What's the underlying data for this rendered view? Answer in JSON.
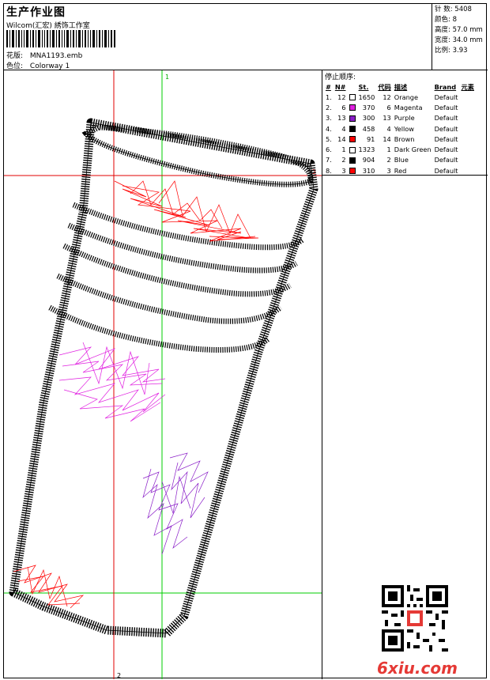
{
  "header": {
    "title": "生产作业图",
    "company": "Wilcom(汇宏) 綉饰工作室",
    "design_label": "花版:",
    "design_file": "MNA1193.emb",
    "colorway_label": "色位:",
    "colorway": "Colorway 1"
  },
  "stats": {
    "stitches_label": "针 数:",
    "stitches": "5408",
    "colors_label": "颜色:",
    "colors": "8",
    "height_label": "高度:",
    "height": "57.0 mm",
    "width_label": "宽度:",
    "width": "34.0 mm",
    "scale_label": "比例:",
    "scale": "3.93"
  },
  "stop_sequence": {
    "title": "停止顺序:",
    "headers": [
      "#",
      "N#",
      "",
      "St.",
      "代码",
      "描述",
      "Brand",
      "元素"
    ],
    "rows": [
      {
        "idx": "1.",
        "n": "12",
        "color": "#ffffff",
        "st": "1650",
        "code": "12",
        "desc": "Orange",
        "brand": "Default"
      },
      {
        "idx": "2.",
        "n": "6",
        "color": "#e020e0",
        "st": "370",
        "code": "6",
        "desc": "Magenta",
        "brand": "Default"
      },
      {
        "idx": "3.",
        "n": "13",
        "color": "#8a1ec8",
        "st": "300",
        "code": "13",
        "desc": "Purple",
        "brand": "Default"
      },
      {
        "idx": "4.",
        "n": "4",
        "color": "#000000",
        "st": "458",
        "code": "4",
        "desc": "Yellow",
        "brand": "Default"
      },
      {
        "idx": "5.",
        "n": "14",
        "color": "#ff0000",
        "st": "91",
        "code": "14",
        "desc": "Brown",
        "brand": "Default"
      },
      {
        "idx": "6.",
        "n": "1",
        "color": "#ffffff",
        "st": "1323",
        "code": "1",
        "desc": "Dark Green",
        "brand": "Default"
      },
      {
        "idx": "7.",
        "n": "2",
        "color": "#000000",
        "st": "904",
        "code": "2",
        "desc": "Blue",
        "brand": "Default"
      },
      {
        "idx": "8.",
        "n": "3",
        "color": "#ff0000",
        "st": "310",
        "code": "3",
        "desc": "Red",
        "brand": "Default"
      }
    ]
  },
  "guides": {
    "v_green": "1",
    "h_red": "2",
    "v_red": "2",
    "colors": {
      "green": "#00cc00",
      "red": "#e00000"
    }
  },
  "watermark": "6xiu.com"
}
